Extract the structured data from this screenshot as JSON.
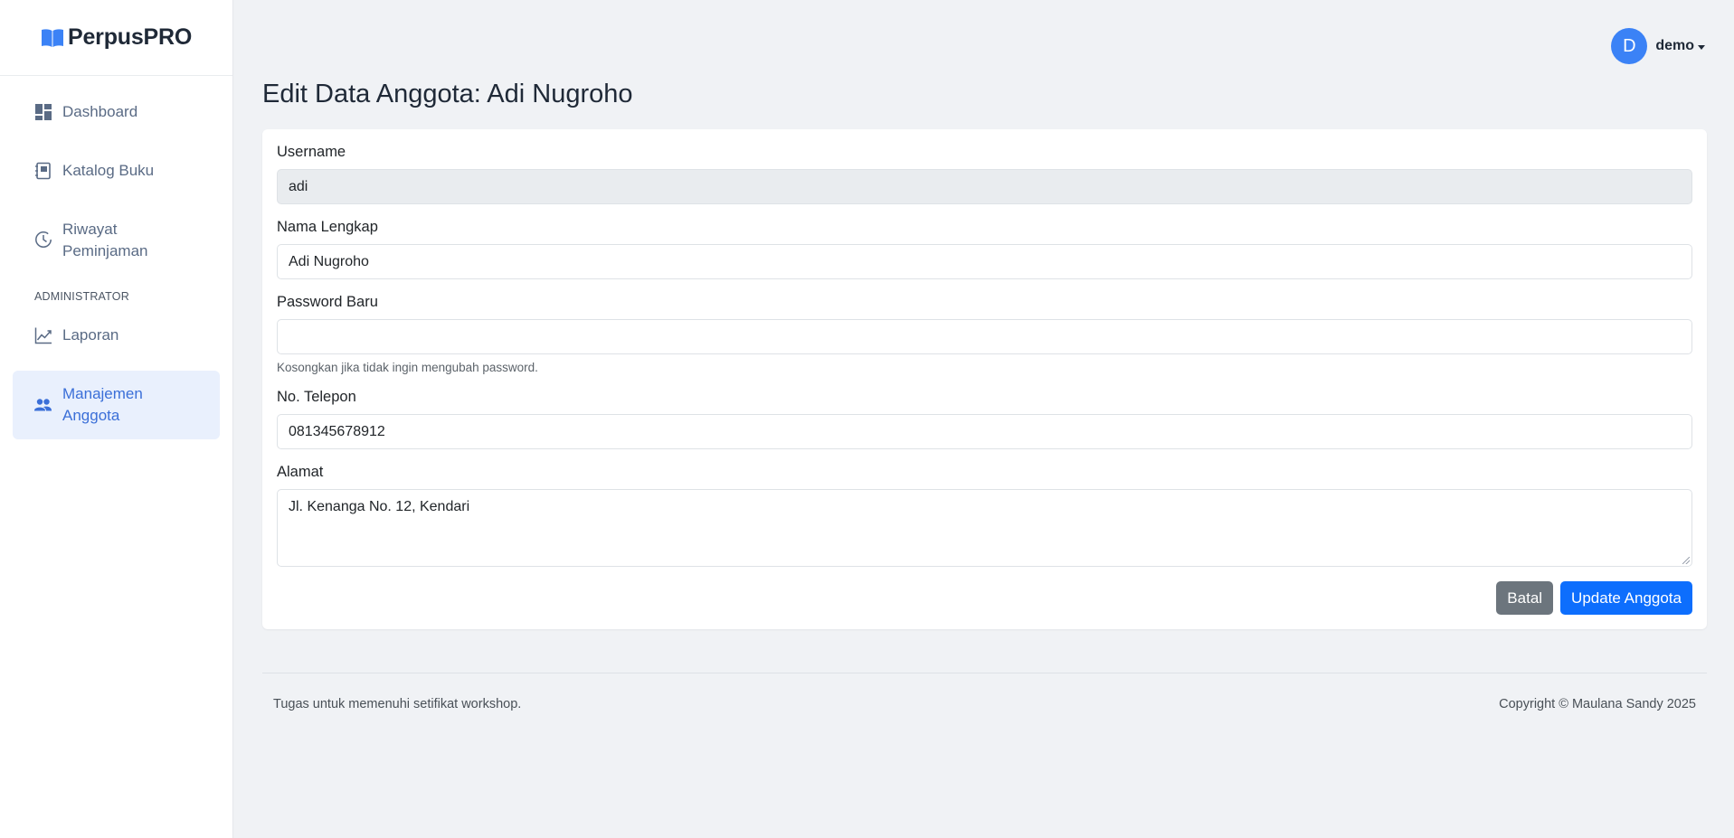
{
  "brand": {
    "name": "PerpusPRO"
  },
  "sidebar": {
    "items": [
      {
        "label": "Dashboard"
      },
      {
        "label": "Katalog Buku"
      },
      {
        "label": "Riwayat Peminjaman"
      }
    ],
    "section_title": "ADMINISTRATOR",
    "admin_items": [
      {
        "label": "Laporan"
      },
      {
        "label": "Manajemen Anggota"
      }
    ]
  },
  "topbar": {
    "avatar_initial": "D",
    "user_name": "demo"
  },
  "page": {
    "title": "Edit Data Anggota: Adi Nugroho"
  },
  "form": {
    "username": {
      "label": "Username",
      "value": "adi"
    },
    "full_name": {
      "label": "Nama Lengkap",
      "value": "Adi Nugroho"
    },
    "password": {
      "label": "Password Baru",
      "value": "",
      "help": "Kosongkan jika tidak ingin mengubah password."
    },
    "phone": {
      "label": "No. Telepon",
      "value": "081345678912"
    },
    "address": {
      "label": "Alamat",
      "value": "Jl. Kenanga No. 12, Kendari"
    },
    "cancel_label": "Batal",
    "submit_label": "Update Anggota"
  },
  "footer": {
    "left": "Tugas untuk memenuhi setifikat workshop.",
    "right": "Copyright © Maulana Sandy 2025"
  },
  "colors": {
    "accent": "#3b6fd8",
    "primary_button": "#0d6efd",
    "secondary_button": "#6c757d",
    "avatar": "#3b82f6"
  }
}
